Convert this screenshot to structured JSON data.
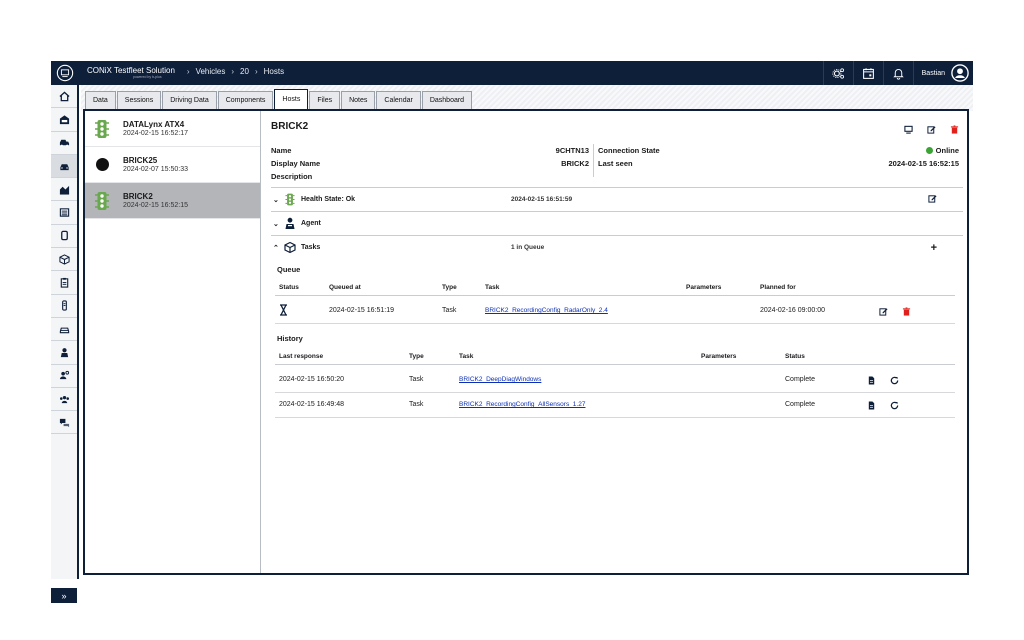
{
  "header": {
    "brand": "CONiX Testfleet Solution",
    "brand_sub": "powered by b-plus",
    "breadcrumb": [
      "Vehicles",
      "20",
      "Hosts"
    ],
    "user": "Bastian"
  },
  "tabs": [
    {
      "label": "Data"
    },
    {
      "label": "Sessions"
    },
    {
      "label": "Driving Data"
    },
    {
      "label": "Components"
    },
    {
      "label": "Hosts",
      "active": true
    },
    {
      "label": "Files"
    },
    {
      "label": "Notes"
    },
    {
      "label": "Calendar"
    },
    {
      "label": "Dashboard"
    }
  ],
  "hosts": [
    {
      "name": "DATALynx ATX4",
      "date": "2024-02-15 16:52:17",
      "icon": "traffic-light-icon"
    },
    {
      "name": "BRICK25",
      "date": "2024-02-07 15:50:33",
      "icon": "black-dot"
    },
    {
      "name": "BRICK2",
      "date": "2024-02-15 16:52:15",
      "icon": "traffic-light-icon",
      "selected": true
    }
  ],
  "detail": {
    "title": "BRICK2",
    "name_label": "Name",
    "name_value": "9CHTN13",
    "display_label": "Display Name",
    "display_value": "BRICK2",
    "description_label": "Description",
    "connection_label": "Connection State",
    "connection_value": "Online",
    "lastseen_label": "Last seen",
    "lastseen_value": "2024-02-15 16:52:15"
  },
  "sections": {
    "health": {
      "label": "Health State: Ok",
      "time": "2024-02-15 16:51:59"
    },
    "agent": {
      "label": "Agent"
    },
    "tasks": {
      "label": "Tasks",
      "count": "1 in Queue"
    }
  },
  "queue": {
    "title": "Queue",
    "headers": {
      "status": "Status",
      "queued": "Queued at",
      "type": "Type",
      "task": "Task",
      "params": "Parameters",
      "planned": "Planned for"
    },
    "rows": [
      {
        "queued": "2024-02-15 16:51:19",
        "type": "Task",
        "task": "BRICK2_RecordingConfig_RadarOnly_2.4",
        "params": "",
        "planned": "2024-02-16 09:00:00"
      }
    ]
  },
  "history": {
    "title": "History",
    "headers": {
      "last": "Last response",
      "type": "Type",
      "task": "Task",
      "params": "Parameters",
      "status": "Status"
    },
    "rows": [
      {
        "last": "2024-02-15 16:50:20",
        "type": "Task",
        "task": "BRICK2_DeepDiagWindows",
        "params": "",
        "status": "Complete"
      },
      {
        "last": "2024-02-15 16:49:48",
        "type": "Task",
        "task": "BRICK2_RecordingConfig_AllSensors_1.27",
        "params": "",
        "status": "Complete"
      }
    ]
  },
  "colors": {
    "navy": "#0e1f3a",
    "online": "#3aa535",
    "delete": "#e0201b",
    "health": "#6aa84f",
    "link": "#0d2fb5"
  }
}
